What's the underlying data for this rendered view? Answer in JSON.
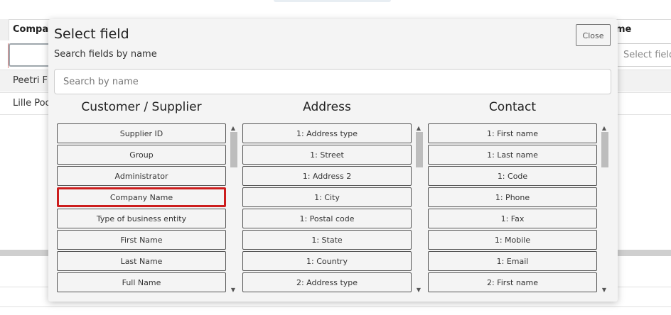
{
  "background": {
    "table_header_left": "Compan",
    "table_header_right": "me",
    "select_placeholder": "Select field",
    "rows": [
      "Peetri F",
      "Lille Poo"
    ]
  },
  "modal": {
    "title": "Select field",
    "subtitle": "Search fields by name",
    "close_label": "Close",
    "search_placeholder": "Search by name",
    "highlight_color": "#cc1d1d",
    "columns": [
      {
        "title": "Customer / Supplier",
        "fields": [
          "Supplier ID",
          "Group",
          "Administrator",
          "Company Name",
          "Type of business entity",
          "First Name",
          "Last Name",
          "Full Name"
        ]
      },
      {
        "title": "Address",
        "fields": [
          "1: Address type",
          "1: Street",
          "1: Address 2",
          "1: City",
          "1: Postal code",
          "1: State",
          "1: Country",
          "2: Address type"
        ]
      },
      {
        "title": "Contact",
        "fields": [
          "1: First name",
          "1: Last name",
          "1: Code",
          "1: Phone",
          "1: Fax",
          "1: Mobile",
          "1: Email",
          "2: First name"
        ]
      }
    ],
    "highlighted_field": "Company Name"
  }
}
